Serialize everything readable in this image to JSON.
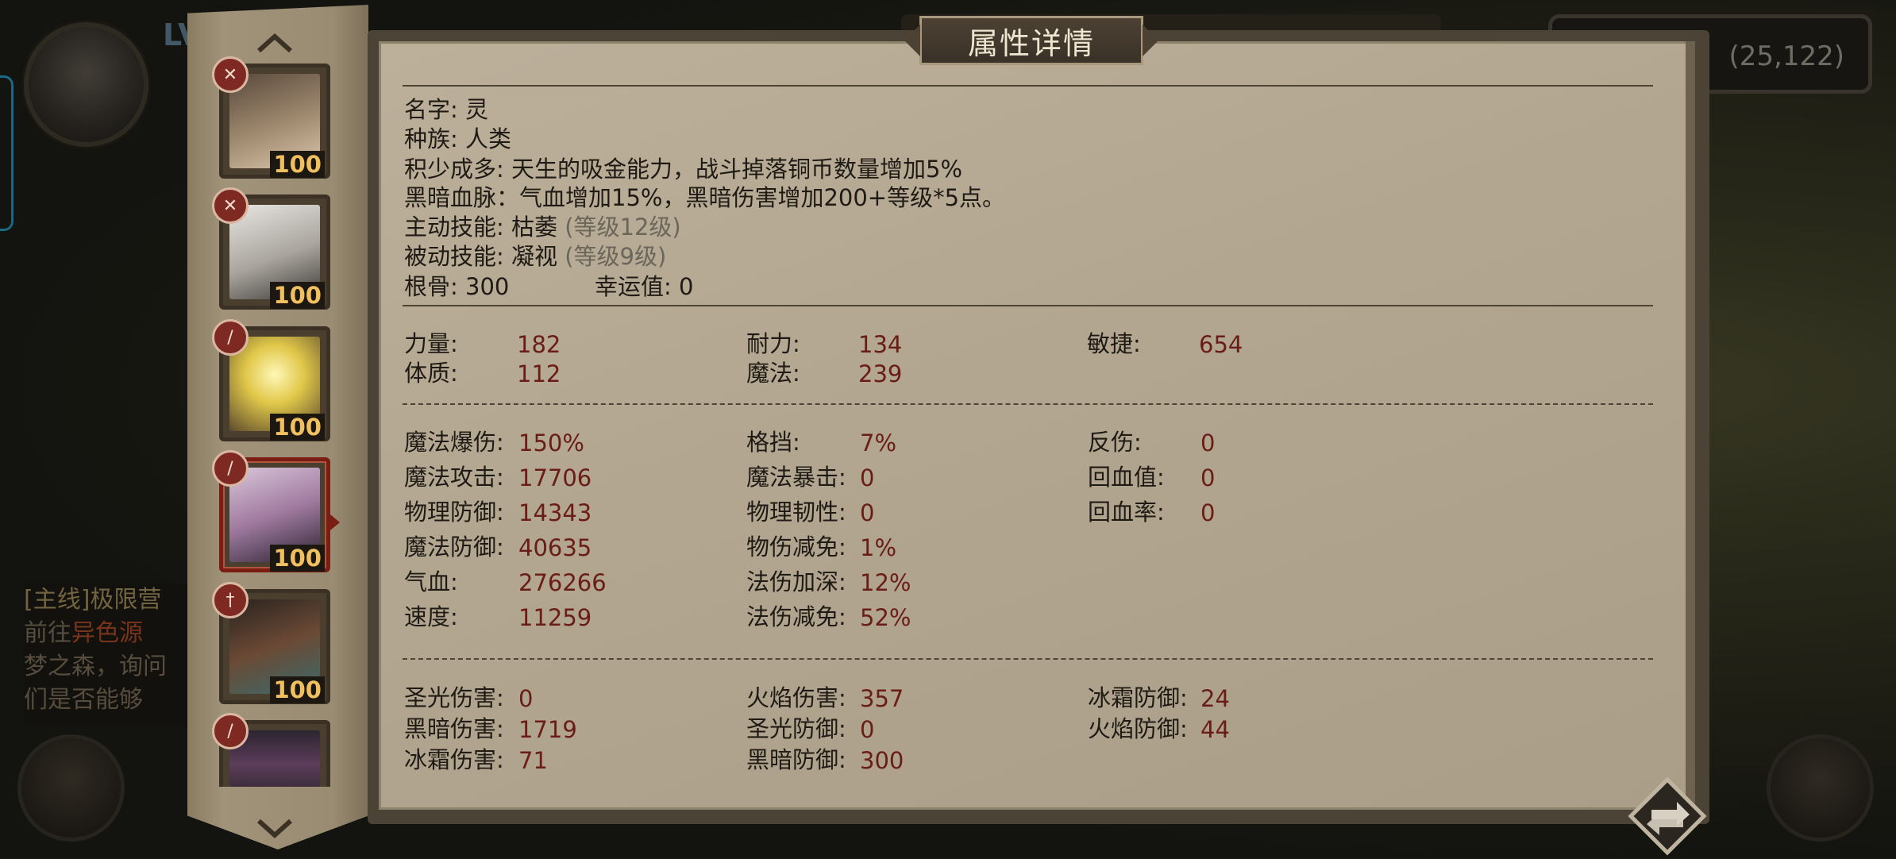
{
  "hud": {
    "lv_label": "LV",
    "coordinates": "(25,122)",
    "quest_title": "[主线]极限营",
    "quest_line1_prefix": "前往",
    "quest_line1_highlight": "异色源",
    "quest_line2": "梦之森，询问",
    "quest_line3": "们是否能够"
  },
  "panel": {
    "title": "属性详情",
    "info": {
      "name": "名字: 灵",
      "race": "种族: 人类",
      "trait1": "积少成多: 天生的吸金能力，战斗掉落铜币数量增加5%",
      "trait2": "黑暗血脉：气血增加15%，黑暗伤害增加200+等级*5点。",
      "active_skill_label": "主动技能: 枯萎",
      "active_skill_level": "(等级12级)",
      "passive_skill_label": "被动技能: 凝视",
      "passive_skill_level": "(等级9级)",
      "root_bone": "根骨: 300",
      "luck": "幸运值: 0"
    },
    "base_stats": [
      {
        "label": "力量:",
        "value": "182"
      },
      {
        "label": "耐力:",
        "value": "134"
      },
      {
        "label": "敏捷:",
        "value": "654"
      },
      {
        "label": "体质:",
        "value": "112"
      },
      {
        "label": "魔法:",
        "value": "239"
      }
    ],
    "combat_col1": [
      {
        "label": "魔法爆伤:",
        "value": "150%"
      },
      {
        "label": "魔法攻击:",
        "value": "17706"
      },
      {
        "label": "物理防御:",
        "value": "14343"
      },
      {
        "label": "魔法防御:",
        "value": "40635"
      },
      {
        "label": "气血:",
        "value": "276266"
      },
      {
        "label": "速度:",
        "value": "11259"
      }
    ],
    "combat_col2": [
      {
        "label": "格挡:",
        "value": "7%"
      },
      {
        "label": "魔法暴击:",
        "value": "0"
      },
      {
        "label": "物理韧性:",
        "value": "0"
      },
      {
        "label": "物伤减免:",
        "value": "1%"
      },
      {
        "label": "法伤加深:",
        "value": "12%"
      },
      {
        "label": "法伤减免:",
        "value": "52%"
      }
    ],
    "combat_col3": [
      {
        "label": "反伤:",
        "value": "0"
      },
      {
        "label": "回血值:",
        "value": "0"
      },
      {
        "label": "回血率:",
        "value": "0"
      }
    ],
    "element_col1": [
      {
        "label": "圣光伤害:",
        "value": "0"
      },
      {
        "label": "黑暗伤害:",
        "value": "1719"
      },
      {
        "label": "冰霜伤害:",
        "value": "71"
      }
    ],
    "element_col2": [
      {
        "label": "火焰伤害:",
        "value": "357"
      },
      {
        "label": "圣光防御:",
        "value": "0"
      },
      {
        "label": "黑暗防御:",
        "value": "300"
      }
    ],
    "element_col3": [
      {
        "label": "冰霜防御:",
        "value": "24"
      },
      {
        "label": "火焰防御:",
        "value": "44"
      }
    ]
  },
  "characters": [
    {
      "level": "100",
      "class_icon": "crossed-swords-icon",
      "color": "#7a6a58"
    },
    {
      "level": "100",
      "class_icon": "crossed-swords-icon",
      "color": "#c8c4bc"
    },
    {
      "level": "100",
      "class_icon": "sword-icon",
      "color": "#d8c048"
    },
    {
      "level": "100",
      "class_icon": "sword-icon",
      "color": "#8c6a8e"
    },
    {
      "level": "100",
      "class_icon": "dagger-icon",
      "color": "#5a4032"
    },
    {
      "level": "",
      "class_icon": "sword-icon",
      "color": "#4a3a4c"
    }
  ],
  "colors": {
    "value_text": "#6a1d16",
    "panel_bg": "#b2a690",
    "level_badge": "#f0c060",
    "active_border": "#7a1e14"
  }
}
